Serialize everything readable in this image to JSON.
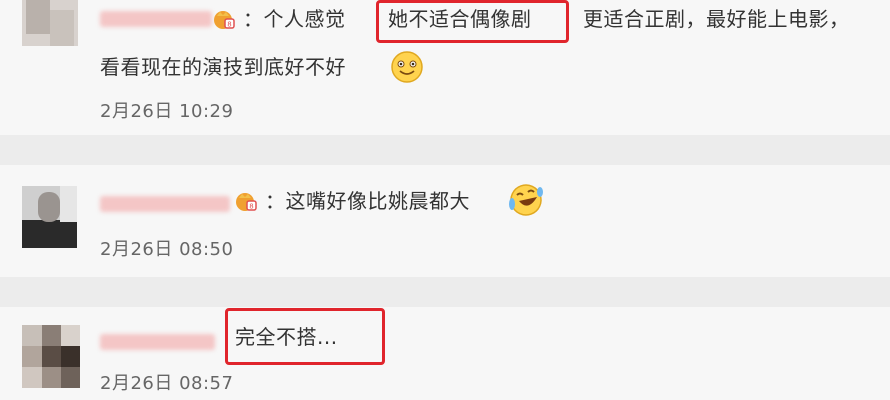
{
  "comments": [
    {
      "prefix": "：个人感觉",
      "highlight": "她不适合偶像剧",
      "suffix": "更适合正剧，最好能上电影，",
      "line2": "看看现在的演技到底好不好",
      "time": "2月26日 10:29",
      "emoji": "smile-emoji"
    },
    {
      "text": "：这嘴好像比姚晨都大",
      "time": "2月26日 08:50",
      "emoji": "laugh-cry-emoji"
    },
    {
      "highlight": "完全不搭...",
      "time": "2月26日 08:57"
    }
  ],
  "colors": {
    "highlight_border": "#e0252c",
    "name_blur": "#f4c6c6",
    "badge": "#f0a030"
  }
}
